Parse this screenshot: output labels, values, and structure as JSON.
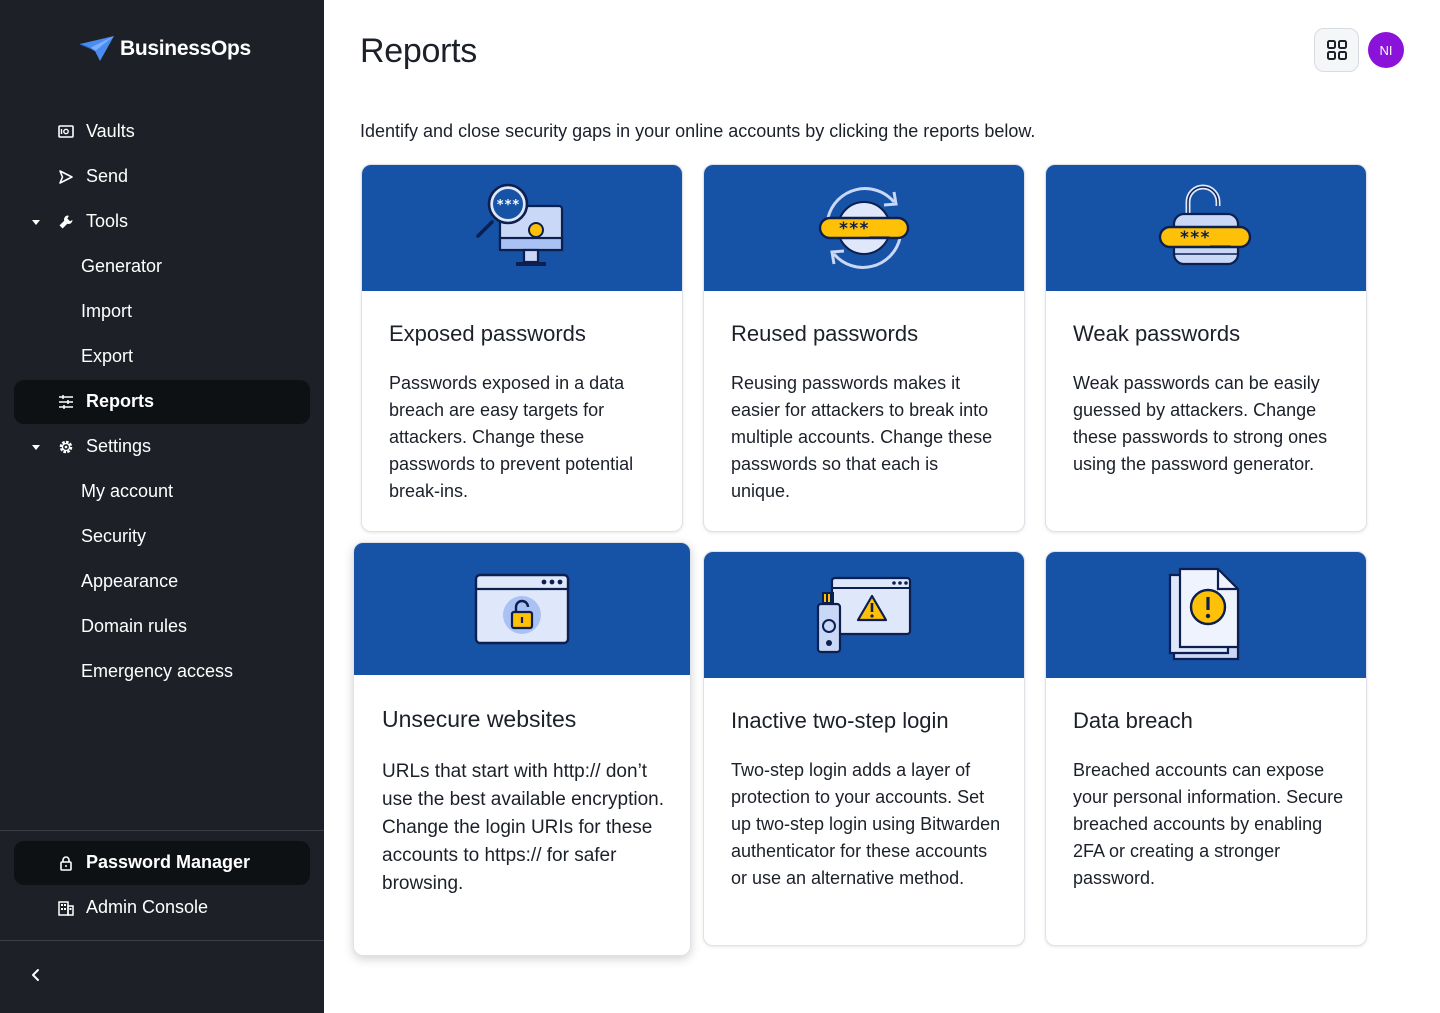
{
  "app": {
    "brand": "BusinessOps"
  },
  "sidebar": {
    "items": [
      {
        "label": "Vaults",
        "icon": "vault-icon"
      },
      {
        "label": "Send",
        "icon": "send-icon"
      },
      {
        "label": "Tools",
        "icon": "wrench-icon"
      },
      {
        "label": "Generator"
      },
      {
        "label": "Import"
      },
      {
        "label": "Export"
      },
      {
        "label": "Reports",
        "icon": "reports-icon",
        "active": true
      },
      {
        "label": "Settings",
        "icon": "gear-icon"
      },
      {
        "label": "My account"
      },
      {
        "label": "Security"
      },
      {
        "label": "Appearance"
      },
      {
        "label": "Domain rules"
      },
      {
        "label": "Emergency access"
      }
    ],
    "footer": [
      {
        "label": "Password Manager",
        "icon": "lock-icon",
        "active": true
      },
      {
        "label": "Admin Console",
        "icon": "building-icon"
      }
    ]
  },
  "header": {
    "title": "Reports",
    "avatar_initials": "NI",
    "avatar_color": "#8a12d9"
  },
  "intro": "Identify and close security gaps in your online accounts by clicking the reports below.",
  "colors": {
    "banner": "#1652a6",
    "accent_yellow": "#ffc107",
    "sidebar_bg": "#1d2127"
  },
  "cards": [
    {
      "title": "Exposed passwords",
      "description": "Passwords exposed in a data breach are easy targets for attackers. Change these passwords to prevent potential break-ins.",
      "icon": "exposed-passwords-icon"
    },
    {
      "title": "Reused passwords",
      "description": "Reusing passwords makes it easier for attackers to break into multiple accounts. Change these passwords so that each is unique.",
      "icon": "reused-passwords-icon"
    },
    {
      "title": "Weak passwords",
      "description": "Weak passwords can be easily guessed by attackers. Change these passwords to strong ones using the password generator.",
      "icon": "weak-passwords-icon"
    },
    {
      "title": "Unsecure websites",
      "description": "URLs that start with http:// don’t use the best available encryption. Change the login URIs for these accounts to https:// for safer browsing.",
      "icon": "unsecure-websites-icon"
    },
    {
      "title": "Inactive two-step login",
      "description": "Two-step login adds a layer of protection to your accounts. Set up two-step login using Bitwarden authenticator for these accounts or use an alternative method.",
      "icon": "inactive-2fa-icon"
    },
    {
      "title": "Data breach",
      "description": "Breached accounts can expose your personal information. Secure breached accounts by enabling 2FA or creating a stronger password.",
      "icon": "data-breach-icon"
    }
  ],
  "password_mask": "***__",
  "password_stars": "***"
}
